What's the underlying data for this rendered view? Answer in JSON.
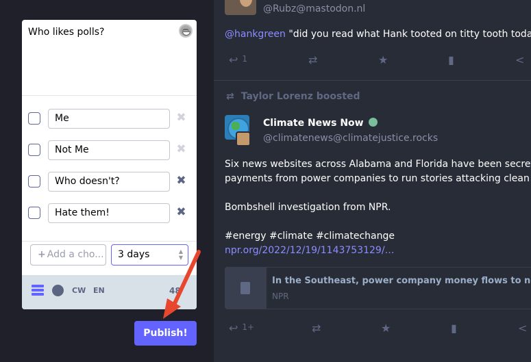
{
  "compose": {
    "text": "Who likes polls?",
    "emoji_icon": "grinning-squint-face-icon",
    "poll": {
      "options": [
        {
          "value": "Me",
          "removable": false
        },
        {
          "value": "Not Me",
          "removable": false
        },
        {
          "value": "Who doesn't?",
          "removable": true
        },
        {
          "value": "Hate them!",
          "removable": true
        }
      ],
      "add_choice_label": "Add a cho...",
      "duration_value": "3 days"
    },
    "toolbar": {
      "poll_icon": "poll-icon",
      "visibility_icon": "globe-icon",
      "cw_label": "CW",
      "language_label": "EN",
      "char_count": "48"
    },
    "publish_label": "Publish!"
  },
  "timeline": {
    "status1": {
      "handle": "@Rubz@mastodon.nl",
      "mention": "@hankgreen",
      "text": " \"did you read what Hank tooted on titty tooth today?\"",
      "reply_count": "1"
    },
    "status2": {
      "boosted_by": "Taylor Lorenz boosted",
      "display_name": "Climate News Now",
      "handle": "@climatenews@climatejustice.rocks",
      "line1": "Six news websites across Alabama and Florida have been secretly t",
      "line2": "payments from power companies to run stories attacking clean ene",
      "line3": "Bombshell investigation from NPR.",
      "hashtags": "#energy #climate #climatechange",
      "link": "npr.org/2022/12/19/1143753129/…",
      "card_title": "In the Southeast, power company money flows to news sites",
      "card_source": "NPR",
      "reply_count": "1+"
    }
  },
  "colors": {
    "accent": "#6364ff",
    "arrow": "#e8472f",
    "timeline_bg": "#282c37"
  }
}
